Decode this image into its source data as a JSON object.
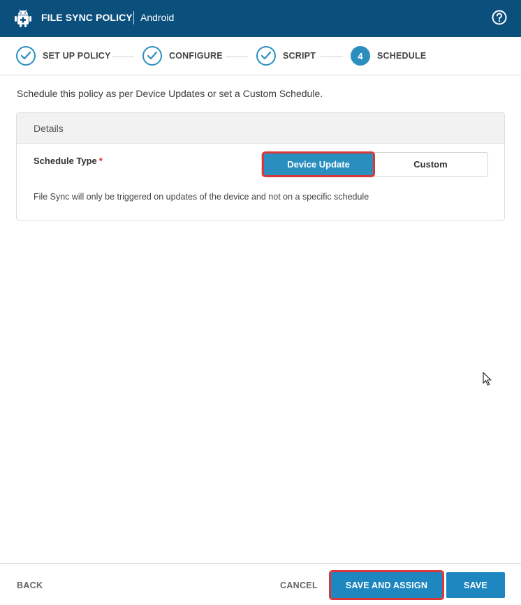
{
  "header": {
    "title": "FILE SYNC POLICY",
    "subtitle": "Android",
    "app_icon": "android-icon",
    "help_icon": "help-circle-icon",
    "bg_color": "#0b4f7d"
  },
  "stepper": {
    "steps": [
      {
        "label": "SET UP POLICY",
        "state": "complete"
      },
      {
        "label": "CONFIGURE",
        "state": "complete"
      },
      {
        "label": "SCRIPT",
        "state": "complete"
      },
      {
        "label": "SCHEDULE",
        "state": "active",
        "number": "4"
      }
    ]
  },
  "content": {
    "intro": "Schedule this policy as per Device Updates or set a Custom Schedule.",
    "details": {
      "heading": "Details",
      "schedule_type_label": "Schedule Type",
      "required_mark": "*",
      "options": [
        "Device Update",
        "Custom"
      ],
      "selected": "Device Update",
      "note": "File Sync will only be triggered on updates of the device and not on a specific schedule"
    }
  },
  "footer": {
    "back": "BACK",
    "cancel": "CANCEL",
    "save_and_assign": "SAVE AND ASSIGN",
    "save": "SAVE"
  },
  "colors": {
    "accent": "#2a8fbf",
    "highlight": "#d8383a"
  }
}
